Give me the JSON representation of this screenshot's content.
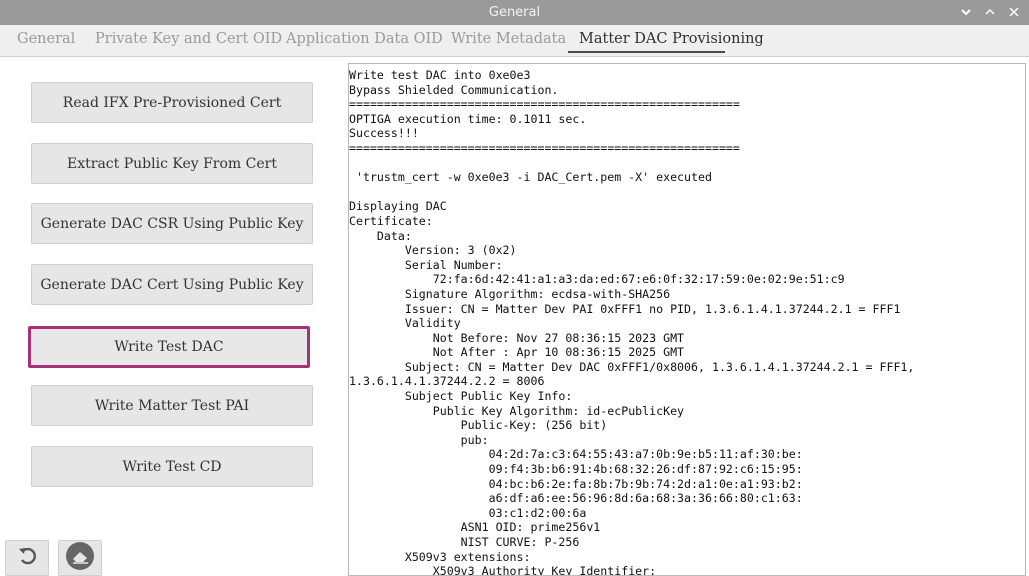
{
  "window": {
    "title": "General"
  },
  "tabs": [
    {
      "label": "General"
    },
    {
      "label": "Private Key and Cert OID"
    },
    {
      "label": "Application Data OID"
    },
    {
      "label": "Write Metadata"
    },
    {
      "label": "Matter DAC Provisioning"
    }
  ],
  "active_tab": "Matter DAC Provisioning",
  "buttons": [
    {
      "label": "Read IFX Pre-Provisioned Cert"
    },
    {
      "label": "Extract Public Key From Cert"
    },
    {
      "label": "Generate DAC CSR Using Public Key"
    },
    {
      "label": "Generate DAC Cert Using Public Key"
    },
    {
      "label": "Write Test DAC"
    },
    {
      "label": "Write Matter Test PAI"
    },
    {
      "label": "Write Test CD"
    }
  ],
  "focused_button": "Write Test DAC",
  "bottom_icons": [
    {
      "icon": "back-arrow-icon"
    },
    {
      "icon": "eraser-icon"
    }
  ],
  "colors": {
    "titlebar": "#9a9a9a",
    "focus_border": "#a8327a",
    "panel": "#ffffff"
  },
  "console": {
    "text": "Write test DAC into 0xe0e3\nBypass Shielded Communication.\n========================================================\nOPTIGA execution time: 0.1011 sec.\nSuccess!!!\n========================================================\n\n 'trustm_cert -w 0xe0e3 -i DAC_Cert.pem -X' executed\n\nDisplaying DAC\nCertificate:\n    Data:\n        Version: 3 (0x2)\n        Serial Number:\n            72:fa:6d:42:41:a1:a3:da:ed:67:e6:0f:32:17:59:0e:02:9e:51:c9\n        Signature Algorithm: ecdsa-with-SHA256\n        Issuer: CN = Matter Dev PAI 0xFFF1 no PID, 1.3.6.1.4.1.37244.2.1 = FFF1\n        Validity\n            Not Before: Nov 27 08:36:15 2023 GMT\n            Not After : Apr 10 08:36:15 2025 GMT\n        Subject: CN = Matter Dev DAC 0xFFF1/0x8006, 1.3.6.1.4.1.37244.2.1 = FFF1,\n1.3.6.1.4.1.37244.2.2 = 8006\n        Subject Public Key Info:\n            Public Key Algorithm: id-ecPublicKey\n                Public-Key: (256 bit)\n                pub:\n                    04:2d:7a:c3:64:55:43:a7:0b:9e:b5:11:af:30:be:\n                    09:f4:3b:b6:91:4b:68:32:26:df:87:92:c6:15:95:\n                    04:bc:b6:2e:fa:8b:7b:9b:74:2d:a1:0e:a1:93:b2:\n                    a6:df:a6:ee:56:96:8d:6a:68:3a:36:66:80:c1:63:\n                    03:c1:d2:00:6a\n                ASN1 OID: prime256v1\n                NIST CURVE: P-256\n        X509v3 extensions:\n            X509v3 Authority Key Identifier:"
  }
}
